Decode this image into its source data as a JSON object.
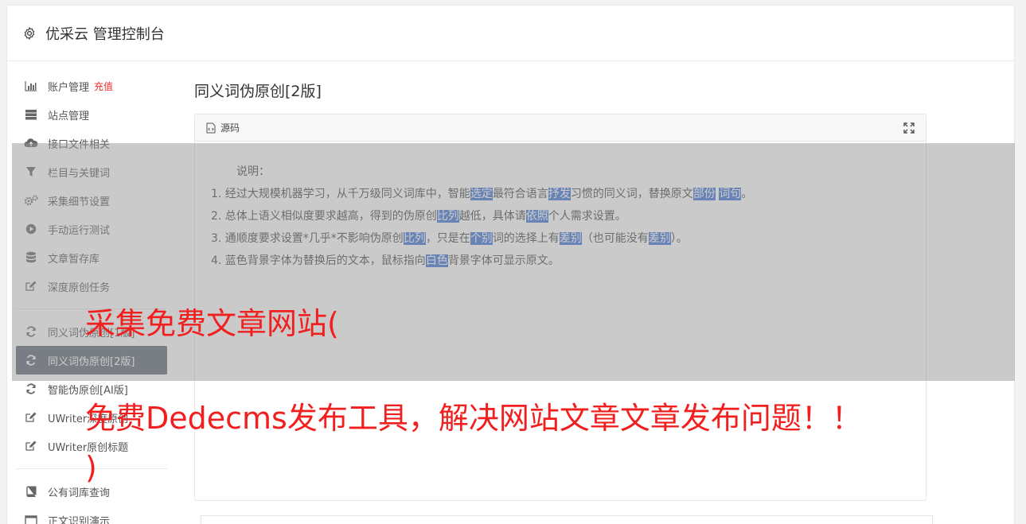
{
  "header": {
    "title": "优采云 管理控制台",
    "icon": "gear-icon"
  },
  "sidebar": {
    "items": [
      {
        "label": "账户管理",
        "extra": "充值",
        "icon": "bar-chart-icon"
      },
      {
        "label": "站点管理",
        "icon": "server-icon"
      },
      {
        "label": "接口文件相关",
        "icon": "cloud-upload-icon"
      },
      {
        "label": "栏目与关键词",
        "icon": "filter-icon"
      },
      {
        "label": "采集细节设置",
        "icon": "gears-icon"
      },
      {
        "label": "手动运行测试",
        "icon": "play-circle-icon"
      },
      {
        "label": "文章暂存库",
        "icon": "database-icon"
      },
      {
        "label": "深度原创任务",
        "icon": "edit-icon"
      },
      {
        "label": "同义词伪原创[1版]",
        "icon": "refresh-icon"
      },
      {
        "label": "同义词伪原创[2版]",
        "icon": "refresh-icon",
        "active": true
      },
      {
        "label": "智能伪原创[AI版]",
        "icon": "refresh-icon"
      },
      {
        "label": "UWriter深度原创",
        "icon": "edit-icon"
      },
      {
        "label": "UWriter原创标题",
        "icon": "edit-icon"
      },
      {
        "label": "公有词库查询",
        "icon": "book-icon"
      },
      {
        "label": "正文识别演示",
        "icon": "window-icon"
      }
    ]
  },
  "main": {
    "heading": "同义词伪原创[2版]",
    "editor": {
      "toolbar_label": "源码",
      "intro": "说明：",
      "lines": [
        [
          {
            "t": "1. 经过大规模机器学习，从千万级同义词库中，智能"
          },
          {
            "t": "选定",
            "h": 1
          },
          {
            "t": "最符合语言"
          },
          {
            "t": "抒发",
            "h": 1
          },
          {
            "t": "习惯的同义词，替换原文"
          },
          {
            "t": "部份",
            "h": 1
          },
          {
            "t": " "
          },
          {
            "t": "词句",
            "h": 1
          },
          {
            "t": "。"
          }
        ],
        [
          {
            "t": "2. 总体上语义相似度要求越高，得到的伪原创"
          },
          {
            "t": "比列",
            "h": 1
          },
          {
            "t": "越低，具体请"
          },
          {
            "t": "依照",
            "h": 1
          },
          {
            "t": "个人需求设置。"
          }
        ],
        [
          {
            "t": "3. 通顺度要求设置*几乎*不影响伪原创"
          },
          {
            "t": "比列",
            "h": 1
          },
          {
            "t": "，只是在"
          },
          {
            "t": "个别",
            "h": 1
          },
          {
            "t": "词的选择上有"
          },
          {
            "t": "差别",
            "h": 1
          },
          {
            "t": "（也可能没有"
          },
          {
            "t": "差别",
            "h": 1
          },
          {
            "t": "）。"
          }
        ],
        [
          {
            "t": "4. 蓝色背景字体为替换后的文本，鼠标指向"
          },
          {
            "t": "白色",
            "h": 1
          },
          {
            "t": "背景字体可显示原文。"
          }
        ]
      ]
    }
  },
  "watermark": {
    "line1": "采集免费文章网站(",
    "line2": "免费Dedecms发布工具，解决网站文章文章发布问题！！",
    "line3": ")"
  },
  "colors": {
    "accent": "#3a73d8",
    "active_nav": "#5a6670",
    "watermark": "#f21f1f",
    "recharge": "#ed2b2b"
  }
}
